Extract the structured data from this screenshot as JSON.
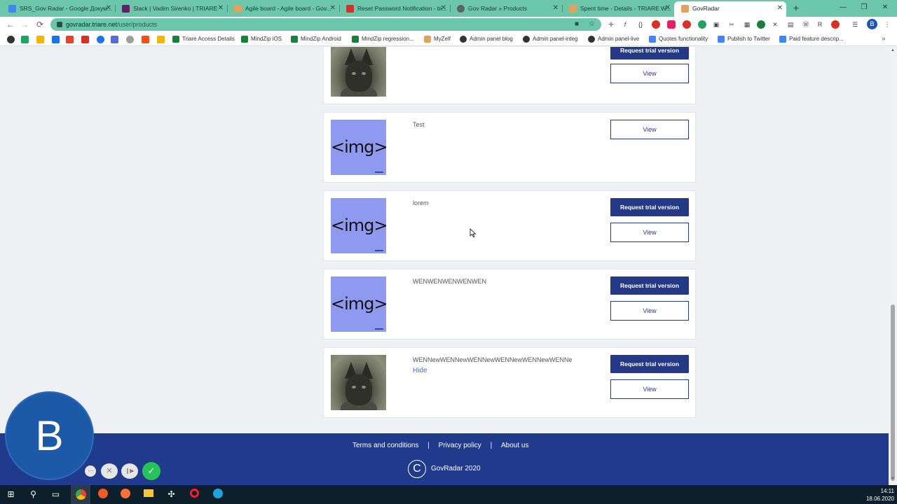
{
  "browser": {
    "tabs": [
      {
        "label": "SRS_Gov Radar - Google Докум...",
        "icon_color": "#4285f4",
        "active": false
      },
      {
        "label": "Slack | Vadim Sirenko | TRIARE",
        "icon_color": "#611f69",
        "active": false
      },
      {
        "label": "Agile board - Agile board - Gov...",
        "icon_color": "#e0a25c",
        "active": false
      },
      {
        "label": "Reset Password Notification - bi...",
        "icon_color": "#d93025",
        "active": false
      },
      {
        "label": "Gov Radar » Products",
        "icon_color": "#5f6368",
        "active": false
      },
      {
        "label": "Spent time - Details - TRIARE W...",
        "icon_color": "#e0a25c",
        "active": false
      },
      {
        "label": "GovRadar",
        "icon_color": "#e0a25c",
        "active": true
      }
    ],
    "new_tab_symbol": "+",
    "window_controls": {
      "minimize": "—",
      "restore": "❐",
      "close": "✕"
    },
    "url_host": "govradar.triare.net",
    "url_path": "/user/products",
    "profile_initial": "B",
    "bookmarks": [
      {
        "label": "Triare Access Details",
        "color": "#188038"
      },
      {
        "label": "MindZip iOS",
        "color": "#188038"
      },
      {
        "label": "MindZip Android",
        "color": "#188038"
      },
      {
        "label": "MindZip regression...",
        "color": "#188038"
      },
      {
        "label": "MyZelf",
        "color": "#e0a25c"
      },
      {
        "label": "Admin panel blog",
        "color": "#333333"
      },
      {
        "label": "Admin panel-integ",
        "color": "#333333"
      },
      {
        "label": "Admin panel-live",
        "color": "#333333"
      },
      {
        "label": "Quotes functionality",
        "color": "#4285f4"
      },
      {
        "label": "Publish to Twitter",
        "color": "#4285f4"
      },
      {
        "label": "Paid feature descrip...",
        "color": "#4285f4"
      }
    ],
    "bookmarks_more": "»"
  },
  "products": [
    {
      "title": "",
      "image": "photo",
      "trial_label": "Request trial version",
      "view_label": "View",
      "show_trial": true
    },
    {
      "title": "Test",
      "image": "placeholder",
      "placeholder_text": "<img>",
      "trial_label": "",
      "view_label": "View",
      "show_trial": false
    },
    {
      "title": "lorem",
      "image": "placeholder",
      "placeholder_text": "<img>",
      "trial_label": "Request trial version",
      "view_label": "View",
      "show_trial": true
    },
    {
      "title": "WENWENWENWENWEN",
      "image": "placeholder",
      "placeholder_text": "<img>",
      "trial_label": "Request trial version",
      "view_label": "View",
      "show_trial": true
    },
    {
      "title": "WENNewWENNewWENNewWENNewWENNewWENNe",
      "hide_label": "Hide",
      "image": "photo",
      "trial_label": "Request trial version",
      "view_label": "View",
      "show_trial": true
    }
  ],
  "footer": {
    "terms": "Terms and conditions",
    "privacy": "Privacy policy",
    "about": "About us",
    "separator": "|",
    "copyright_symbol": "C",
    "copyright": "GovRadar 2020",
    "background": "#213b8c"
  },
  "recorder": {
    "initial": "B",
    "more_symbol": "···",
    "cancel_symbol": "✕",
    "pause_symbol": "❙▶",
    "confirm_symbol": "✓"
  },
  "taskbar": {
    "time": "14:11",
    "date": "18.06.2020"
  },
  "colors": {
    "primary_button": "#243a86",
    "link": "#3a6fd4",
    "tab_strip": "#6cc6a9"
  }
}
